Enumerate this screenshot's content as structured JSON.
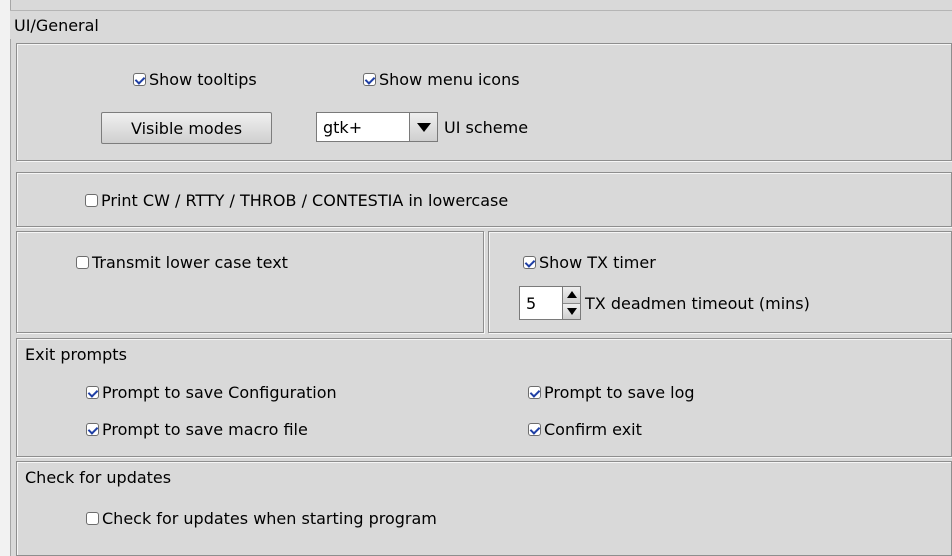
{
  "window": {
    "section_title": "UI/General",
    "colors": {
      "background": "#d9d9d9",
      "border": "#8e8e8e",
      "checkmark": "#1f3fa5"
    }
  },
  "ui_group": {
    "show_tooltips": {
      "label": "Show tooltips",
      "checked": true
    },
    "show_menu_icons": {
      "label": "Show menu icons",
      "checked": true
    },
    "visible_modes_button": "Visible modes",
    "ui_scheme": {
      "value": "gtk+",
      "label": "UI scheme",
      "icon": "chevron-down-icon"
    }
  },
  "lowercase_group": {
    "print_lowercase": {
      "label": "Print CW / RTTY / THROB / CONTESTIA in lowercase",
      "checked": false
    }
  },
  "transmit_group": {
    "transmit_lowercase": {
      "label": "Transmit lower case text",
      "checked": false
    }
  },
  "timer_group": {
    "show_tx_timer": {
      "label": "Show TX timer",
      "checked": true
    },
    "deadman_timeout": {
      "value": "5",
      "label": "TX deadmen timeout (mins)",
      "up_icon": "arrow-up-icon",
      "down_icon": "arrow-down-icon"
    }
  },
  "exit_prompts": {
    "title": "Exit prompts",
    "prompt_save_configuration": {
      "label": "Prompt to save Configuration",
      "checked": true
    },
    "prompt_save_log": {
      "label": "Prompt to save log",
      "checked": true
    },
    "prompt_save_macro_file": {
      "label": "Prompt to save macro file",
      "checked": true
    },
    "confirm_exit": {
      "label": "Confirm exit",
      "checked": true
    }
  },
  "updates": {
    "title": "Check for updates",
    "check_on_start": {
      "label": "Check for updates when starting program",
      "checked": false
    }
  }
}
